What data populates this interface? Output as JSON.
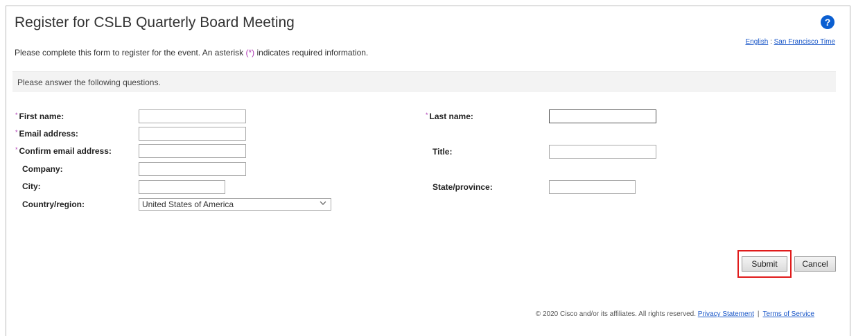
{
  "header": {
    "title": "Register for CSLB Quarterly Board Meeting",
    "help_icon": "question-circle-icon",
    "help_glyph": "?",
    "language_link": "English",
    "locale_separator": ":",
    "timezone_link": "San Francisco Time"
  },
  "intro": {
    "text_before": "Please complete this form to register for the event. An asterisk ",
    "asterisk": "(*)",
    "text_after": " indicates required information."
  },
  "section": {
    "label": "Please answer the following questions."
  },
  "form": {
    "required_marker": "*",
    "first_name": {
      "label": "First name:",
      "value": ""
    },
    "last_name": {
      "label": "Last name:",
      "value": ""
    },
    "email": {
      "label": "Email address:",
      "value": ""
    },
    "confirm_email": {
      "label": "Confirm email address:",
      "value": ""
    },
    "title": {
      "label": "Title:",
      "value": ""
    },
    "company": {
      "label": "Company:",
      "value": ""
    },
    "city": {
      "label": "City:",
      "value": ""
    },
    "state": {
      "label": "State/province:",
      "value": ""
    },
    "country": {
      "label": "Country/region:",
      "selected": "United States of America"
    }
  },
  "actions": {
    "submit_label": "Submit",
    "cancel_label": "Cancel"
  },
  "footer": {
    "copyright": "© 2020 Cisco and/or its affiliates. All rights reserved.",
    "privacy_link": "Privacy Statement",
    "separator": "|",
    "terms_link": "Terms of Service"
  },
  "colors": {
    "required": "#b03bb5",
    "link": "#1a57c8",
    "help_icon": "#0b5fd1",
    "highlight": "#e01b1b"
  }
}
